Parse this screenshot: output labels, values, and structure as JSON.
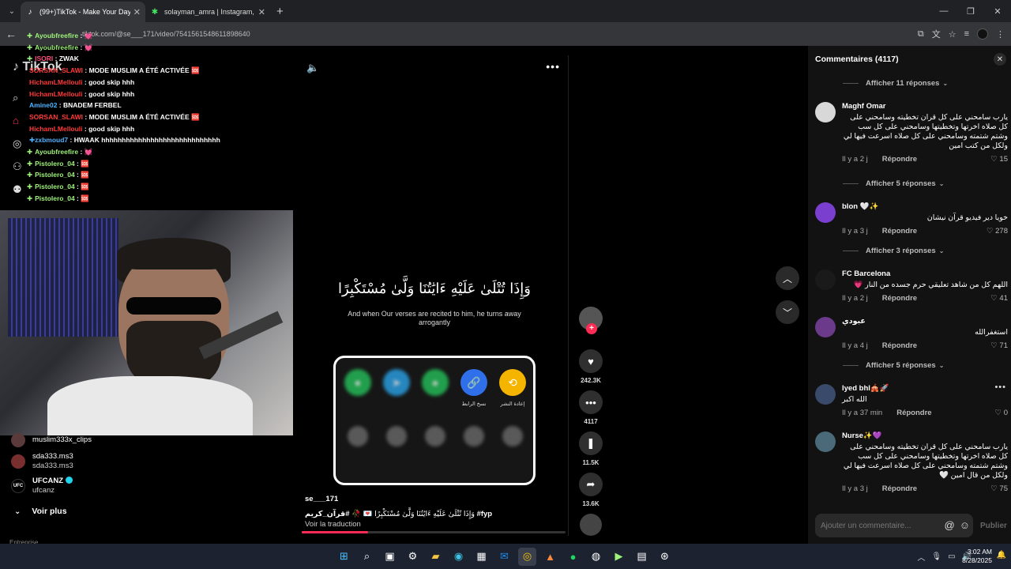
{
  "browser": {
    "tabs": [
      {
        "title": "(99+)TikTok - Make Your Day",
        "icon": "tiktok-icon",
        "active": true
      },
      {
        "title": "solayman_amra | Instagram, Tik",
        "icon": "linktree-icon",
        "active": false
      }
    ],
    "url": "tiktok.com/@se___171/video/7541561548611898640"
  },
  "sidebar": {
    "logo": "TikTok",
    "chat": [
      {
        "user": "Ayoubfreefire",
        "msg": "💓",
        "color": "#9ef27a",
        "icon": "✚"
      },
      {
        "user": "Ayoubfreefire",
        "msg": "💓",
        "color": "#9ef27a",
        "icon": "✚"
      },
      {
        "user": "ISORI",
        "msg": "ZWAK",
        "color": "#ff4f7a",
        "icon": "✚"
      },
      {
        "user": "SORSAN_SLAWI",
        "msg": "MODE MUSLIM A ÉTÉ ACTIVÉE 🆘",
        "color": "#ff3a3a",
        "icon": ""
      },
      {
        "user": "HichamLMellouli",
        "msg": "good skip hhh",
        "color": "#ff3a3a",
        "icon": ""
      },
      {
        "user": "HichamLMellouli",
        "msg": "good skip hhh",
        "color": "#ff3a3a",
        "icon": ""
      },
      {
        "user": "Amine02",
        "msg": "BNADEM FERBEL",
        "color": "#4fb3ff",
        "icon": ""
      },
      {
        "user": "SORSAN_SLAWI",
        "msg": "MODE MUSLIM A ÉTÉ ACTIVÉE 🆘",
        "color": "#ff3a3a",
        "icon": ""
      },
      {
        "user": "HichamLMellouli",
        "msg": "good skip hhh",
        "color": "#ff3a3a",
        "icon": ""
      },
      {
        "user": "✚zxbmoud7",
        "msg": "HWAAK hhhhhhhhhhhhhhhhhhhhhhhhhhhhh",
        "color": "#4fb3ff",
        "icon": ""
      },
      {
        "user": "Ayoubfreefire",
        "msg": "💓",
        "color": "#9ef27a",
        "icon": "✚"
      },
      {
        "user": "Pistolero_04",
        "msg": "🆘",
        "color": "#9ef27a",
        "icon": "✚"
      },
      {
        "user": "Pistolero_04",
        "msg": "🆘",
        "color": "#9ef27a",
        "icon": "✚"
      },
      {
        "user": "Pistolero_04",
        "msg": "🆘",
        "color": "#9ef27a",
        "icon": "✚"
      },
      {
        "user": "Pistolero_04",
        "msg": "🆘",
        "color": "#9ef27a",
        "icon": "✚"
      }
    ],
    "following": [
      {
        "name": "muslim333x_clips",
        "sub": "",
        "verified": false,
        "badge": ""
      },
      {
        "name": "sda333.ms3",
        "sub": "sda333.ms3",
        "verified": false,
        "badge": ""
      },
      {
        "name": "UFCANZ",
        "sub": "ufcanz",
        "verified": true,
        "badge": "UFC"
      }
    ],
    "see_more": "Voir plus",
    "footer": "Entreprise"
  },
  "video": {
    "arabic_verse": "وَإِذَا تُتْلَىٰ عَلَيْهِ ءَايَٰتُنَا وَلَّىٰ مُسْتَكْبِرًا",
    "english_verse": "And when Our verses are recited to him, he turns away arrogantly",
    "share_row1": [
      {
        "label": "",
        "color": "#25c25a",
        "icon": "●"
      },
      {
        "label": "",
        "color": "#2aa3e8",
        "icon": "➤"
      },
      {
        "label": "",
        "color": "#25c25a",
        "icon": "●"
      },
      {
        "label": "نسخ الرابط",
        "color": "#2f6fe9",
        "icon": "🔗"
      },
      {
        "label": "إعادة النشر",
        "color": "#f5b400",
        "icon": "⟲"
      }
    ],
    "share_row2": [
      "",
      "",
      "",
      "",
      ""
    ],
    "author": "se___171",
    "caption_text": "وَإِذَا تُتْلَىٰ عَلَيْهِ ءَايَٰتُنَا وَلَّىٰ مُسْتَكْبِرًا 💌 🥀",
    "caption_tags": "#قرآن_كريم #fyp",
    "translate": "Voir la traduction",
    "progress": 0.25
  },
  "actions": {
    "likes": "242.3K",
    "comments": "4117",
    "saves": "11.5K",
    "shares": "13.6K"
  },
  "comments": {
    "header": "Commentaires (4117)",
    "reply_prefix": "Afficher",
    "reply_suffix": "réponses",
    "replies": [
      {
        "text": "Afficher 11 réponses"
      },
      {
        "text": "Afficher 5 réponses"
      },
      {
        "text": "Afficher 3 réponses"
      },
      {
        "text": "Afficher 5 réponses"
      }
    ],
    "reply_label": "Répondre",
    "items": [
      {
        "name": "Maghf Omar",
        "text": "يارب سامحني على كل قران تخطيته وسامحني على كل صلاه اخرتها وتخطيتها وسامحني على كل سب وشتم شتمته وسامحني على كل صلاه اسرعت فيها لي ولكل من كتب امين",
        "time": "Il y a 2 j",
        "likes": "15",
        "avatar": "#d8d8d8",
        "rtl": true
      },
      {
        "name": "blon 🤍✨",
        "text": "خويا دير فيديو قرآن نيشان",
        "time": "Il y a 3 j",
        "likes": "278",
        "avatar": "#7b3fd0",
        "rtl": true
      },
      {
        "name": "FC Barcelona",
        "text": "اللهم كل من شاهد تعليقي حرم جسده من النار 💗",
        "time": "Il y a 2 j",
        "likes": "41",
        "avatar": "#1a1a1a",
        "rtl": true
      },
      {
        "name": "عبودي",
        "text": "استغفرالله",
        "time": "Il y a 4 j",
        "likes": "71",
        "avatar": "#6b3a8a",
        "rtl": true
      },
      {
        "name": "Iyed bhl🎪🚀",
        "text": "الله اكبر",
        "time": "Il y a 37 min",
        "likes": "0",
        "avatar": "#3a4a6a",
        "rtl": true
      },
      {
        "name": "Nurse✨💜",
        "text": "يارب سامحني على كل قران تخطيته وسامحني على كل صلاه اخرتها وتخطيتها وسامحني على كل سب وشتم شتمته وسامحني على كل صلاه اسرعت فيها لي ولكل من قال امين 🤍",
        "time": "Il y a 3 j",
        "likes": "75",
        "avatar": "#4a6a7a",
        "rtl": true
      }
    ],
    "input_placeholder": "Ajouter un commentaire...",
    "publish": "Publier"
  },
  "taskbar": {
    "time": "3:02 AM",
    "date": "8/28/2025"
  }
}
